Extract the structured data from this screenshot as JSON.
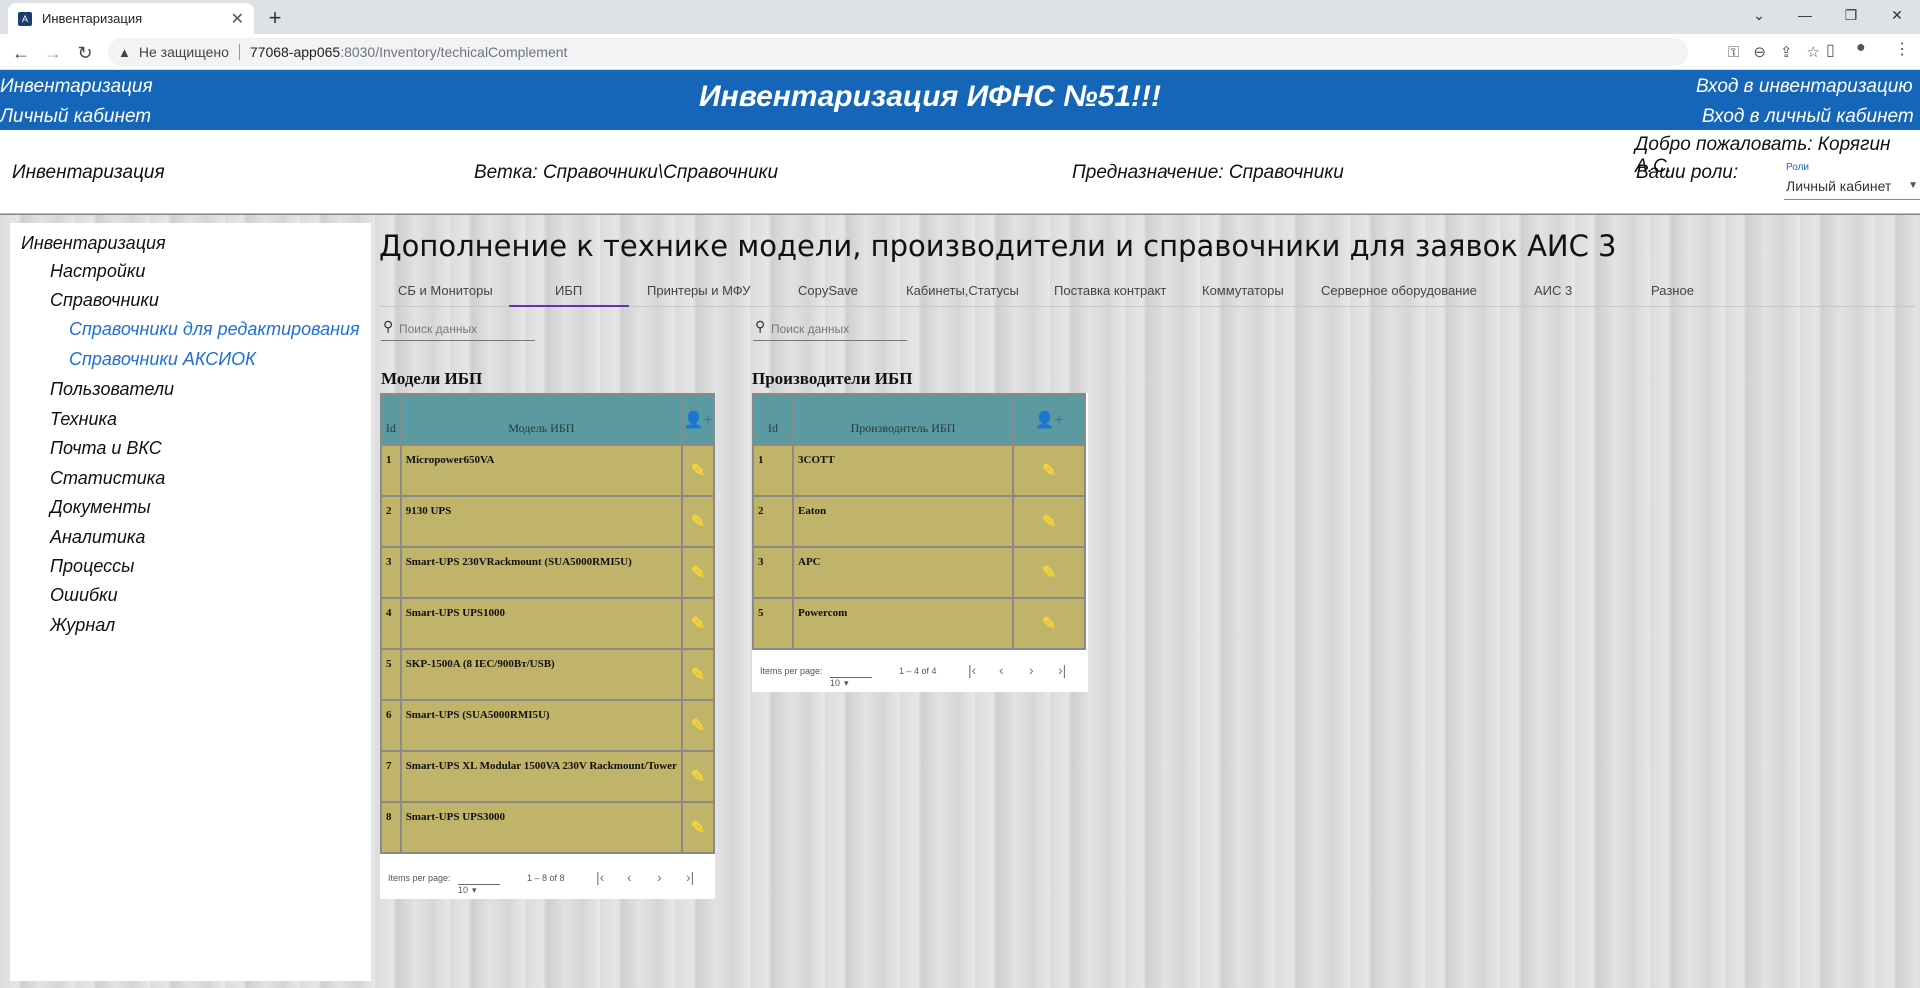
{
  "browser": {
    "tab_title": "Инвентаризация",
    "tab_close": "✕",
    "new_tab": "+",
    "security_warning": "Не защищено",
    "url_host": "77068-app065",
    "url_path": ":8030/Inventory/techicalComplement"
  },
  "header": {
    "left_link_1": "Инвентаризация",
    "left_link_2": "Личный кабинет",
    "title": "Инвентаризация ИФНС №51!!!",
    "right_link_1": "Вход в инвентаризацию",
    "right_link_2": "Вход в личный кабинет"
  },
  "info": {
    "section": "Инвентаризация",
    "branch": "Ветка: Справочники\\Справочники",
    "purpose": "Предназначение: Справочники",
    "welcome": "Добро пожаловать: Корягин А.С.",
    "roles_label": "Ваши роли:",
    "roles_field_label": "Роли",
    "roles_value": "Личный кабинет"
  },
  "sidebar": {
    "items": [
      "Инвентаризация",
      "Настройки",
      "Справочники",
      "Справочники для редактирования",
      "Справочники АКСИОК",
      "Пользователи",
      "Техника",
      "Почта и ВКС",
      "Статистика",
      "Документы",
      "Аналитика",
      "Процессы",
      "Ошибки",
      "Журнал"
    ]
  },
  "main": {
    "title": "Дополнение к технике модели, производители и справочники для заявок АИС 3",
    "tabs": [
      "СБ и Мониторы",
      "ИБП",
      "Принтеры и МФУ",
      "CopySave",
      "Кабинеты,Статусы",
      "Поставка контракт",
      "Коммутаторы",
      "Серверное оборудование",
      "АИС 3",
      "Разное"
    ],
    "active_tab": "ИБП",
    "search_placeholder": "Поиск данных"
  },
  "models_table": {
    "title": "Модели ИБП",
    "headers": [
      "Id",
      "Модель ИБП"
    ],
    "rows": [
      [
        "1",
        "Micropower650VA"
      ],
      [
        "2",
        "9130 UPS"
      ],
      [
        "3",
        "Smart-UPS 230VRackmount (SUA5000RMI5U)"
      ],
      [
        "4",
        "Smart-UPS UPS1000"
      ],
      [
        "5",
        "SKP-1500A (8 IEC/900Вт/USB)"
      ],
      [
        "6",
        "Smart-UPS (SUA5000RMI5U)"
      ],
      [
        "7",
        "Smart-UPS XL Modular 1500VA 230V Rackmount/Tower"
      ],
      [
        "8",
        "Smart-UPS UPS3000"
      ]
    ],
    "pager": {
      "label": "Items per page:",
      "size": "10",
      "range": "1 – 8 of 8"
    }
  },
  "makers_table": {
    "title": "Производители ИБП",
    "headers": [
      "Id",
      "Производитель ИБП"
    ],
    "rows": [
      [
        "1",
        "3COTT"
      ],
      [
        "2",
        "Eaton"
      ],
      [
        "3",
        "APC"
      ],
      [
        "5",
        "Powercom"
      ]
    ],
    "pager": {
      "label": "Items per page:",
      "size": "10",
      "range": "1 – 4 of 4"
    }
  },
  "icons": {
    "edit": "✎",
    "add_user": "👤+",
    "first": "|‹",
    "prev": "‹",
    "next": "›",
    "last": "›|"
  },
  "colors": {
    "header_bg": "#1565b8",
    "table_header_bg": "#5a9aa0",
    "table_cell_bg": "#bfb46a",
    "edit_icon": "#f4d23a",
    "add_icon": "#7b3fb8",
    "link_blue": "#1e6fd9"
  }
}
